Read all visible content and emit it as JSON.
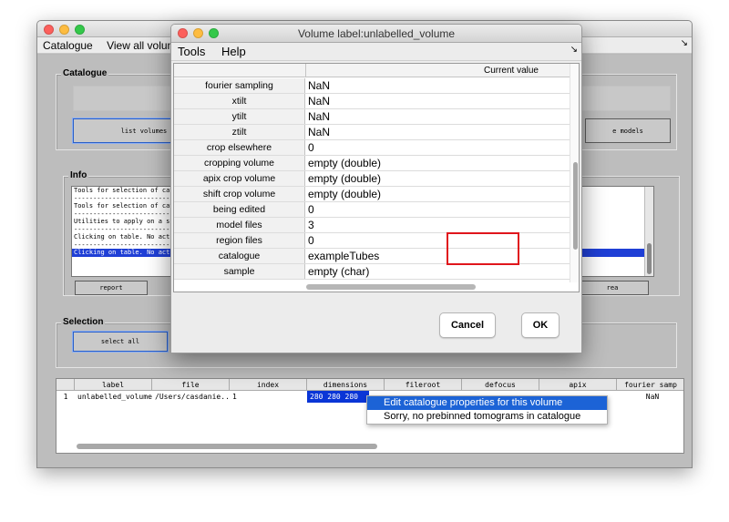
{
  "background_window": {
    "menu": [
      "Catalogue",
      "View all volumes"
    ],
    "corner_arrow": "↘",
    "catalogue_panel": {
      "title": "Catalogue",
      "buttons": [
        "list volumes",
        "e models"
      ]
    },
    "info_panel": {
      "title": "Info",
      "lines": [
        "Tools for selection of catal",
        "----------------------------",
        "Tools for selection of catal",
        "----------------------------",
        "Utilities to apply on a singl",
        "----------------------------",
        "Clicking on table. No actio",
        "----------------------------",
        "Clicking on table. No actio"
      ],
      "buttons": [
        "report",
        "rea"
      ]
    },
    "selection_panel": {
      "title": "Selection",
      "buttons": [
        "select all"
      ]
    },
    "volume_table": {
      "columns": [
        "",
        "label",
        "file",
        "index",
        "dimensions",
        "fileroot",
        "defocus",
        "apix",
        "fourier samp"
      ],
      "row": [
        "1",
        "unlabelled_volume",
        "/Users/casdanie...",
        "1",
        "280 280 280",
        "",
        "",
        "",
        "NaN"
      ]
    },
    "context_menu": [
      "Edit catalogue properties for this volume",
      "Sorry, no prebinned tomograms in catalogue"
    ]
  },
  "dialog": {
    "title": "Volume label:unlabelled_volume",
    "menu": [
      "Tools",
      "Help"
    ],
    "corner_arrow": "↘",
    "header": {
      "name": "",
      "value": "Current value"
    },
    "properties": [
      {
        "name": "fourier sampling",
        "value": "NaN"
      },
      {
        "name": "xtilt",
        "value": "NaN"
      },
      {
        "name": "ytilt",
        "value": "NaN"
      },
      {
        "name": "ztilt",
        "value": "NaN"
      },
      {
        "name": "crop elsewhere",
        "value": "0"
      },
      {
        "name": "cropping volume",
        "value": "empty (double)"
      },
      {
        "name": "apix crop volume",
        "value": "empty (double)"
      },
      {
        "name": "shift crop volume",
        "value": "empty (double)"
      },
      {
        "name": "being edited",
        "value": "0"
      },
      {
        "name": "model files",
        "value": "3"
      },
      {
        "name": "region files",
        "value": "0"
      },
      {
        "name": "catalogue",
        "value": "exampleTubes"
      },
      {
        "name": "sample",
        "value": "empty (char)"
      }
    ],
    "cancel_label": "Cancel",
    "ok_label": "OK"
  },
  "colors": {
    "highlight_box": "#e0161c",
    "selection_blue": "#1f3fd6",
    "menu_highlight": "#1c63d6"
  }
}
